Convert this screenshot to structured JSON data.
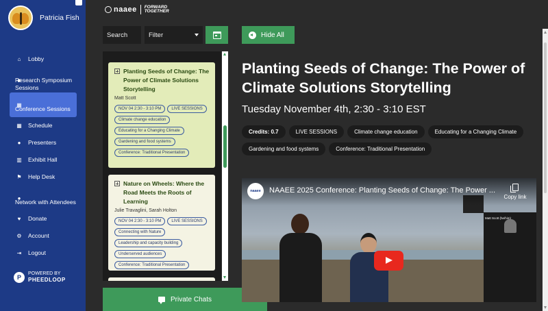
{
  "profile": {
    "name": "Patricia Fish"
  },
  "sidebar": {
    "items": [
      {
        "label": "Lobby",
        "icon": "home-icon"
      },
      {
        "label": "Research Symposium Sessions",
        "icon": "video-icon"
      },
      {
        "label": "Conference Sessions",
        "icon": "calendar-icon",
        "active": true
      },
      {
        "label": "Schedule",
        "icon": "calendar-check-icon"
      },
      {
        "label": "Presenters",
        "icon": "users-icon"
      },
      {
        "label": "Exhibit Hall",
        "icon": "building-icon"
      },
      {
        "label": "Help Desk",
        "icon": "flag-icon"
      },
      {
        "label": "Network with Attendees",
        "icon": "user-group-icon"
      },
      {
        "label": "Donate",
        "icon": "donate-icon"
      },
      {
        "label": "Account",
        "icon": "gear-icon"
      },
      {
        "label": "Logout",
        "icon": "logout-icon"
      }
    ],
    "powered_by": "POWERED BY",
    "powered_brand": "PHEEDLOOP"
  },
  "brand": {
    "name": "naaee",
    "tagline_1": "FORWARD",
    "tagline_2": "TOGETHER"
  },
  "filters": {
    "search_label": "Search",
    "filter_label": "Filter"
  },
  "sessions": [
    {
      "title": "Planting Seeds of Change: The Power of Climate Solutions Storytelling",
      "speakers": "Matt Scott",
      "tags": [
        "NOV 04 2:30 - 3:10 PM",
        "LIVE SESSIONS",
        "Climate change education",
        "Educating for a Changing Climate",
        "Gardening and food systems",
        "Conference: Traditional Presentation"
      ]
    },
    {
      "title": "Nature on Wheels: Where the Road Meets the Roots of Learning",
      "speakers": "Julie Travaglini, Sarah Holton",
      "tags": [
        "NOV 04 2:30 - 3:10 PM",
        "LIVE SESSIONS",
        "Connecting with Nature",
        "Leadership and capacity building",
        "Underserved audiences",
        "Conference: Traditional Presentation"
      ]
    }
  ],
  "private_chats_label": "Private Chats",
  "detail": {
    "hide_all_label": "Hide All",
    "title": "Planting Seeds of Change: The Power of Climate Solutions Storytelling",
    "datetime": "Tuesday November 4th, 2:30 - 3:10 EST",
    "credits_label": "Credits:",
    "credits_value": "0.7",
    "chips": [
      "LIVE SESSIONS",
      "Climate change education",
      "Educating for a Changing Climate",
      "Gardening and food systems",
      "Conference: Traditional Presentation"
    ]
  },
  "video": {
    "channel": "naaee",
    "title": "NAAEE 2025 Conference: Planting Seeds of Change: The Power ...",
    "copy_link_label": "Copy link",
    "inset_name": "Matt Scott (he/him)"
  },
  "colors": {
    "sidebar": "#1d3a86",
    "accent_green": "#3e9a5a",
    "active_nav": "#4a6fd8",
    "background": "#2b2b2b"
  }
}
